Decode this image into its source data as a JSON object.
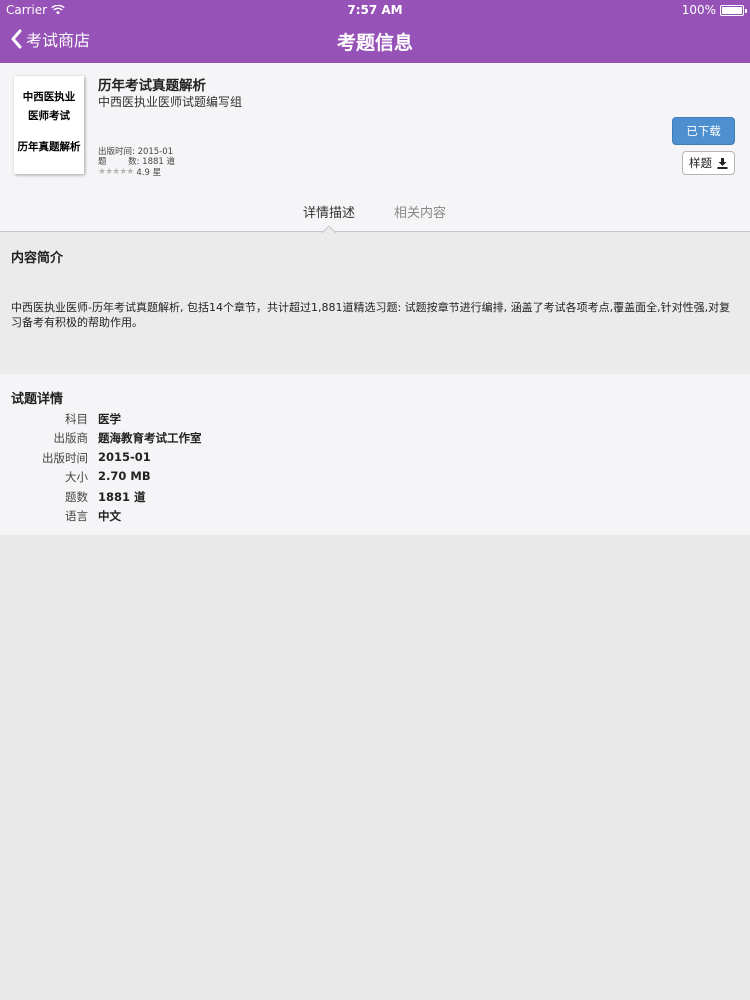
{
  "status_bar": {
    "carrier": "Carrier",
    "time": "7:57 AM",
    "battery": "100%"
  },
  "nav": {
    "back_label": "考试商店",
    "title": "考题信息"
  },
  "product": {
    "cover_lines": [
      "中西医执业",
      "医师考试",
      "历年真题解析"
    ],
    "title": "历年考试真题解析",
    "author": "中西医执业医师试题编写组",
    "publish_date_line": "出版时间: 2015-01",
    "question_count_line": "题        数: 1881 道",
    "rating_value": 0.0,
    "rating_text": "4.9 星",
    "downloaded_label": "已下载",
    "sample_label": "样题"
  },
  "tabs": {
    "details": "详情描述",
    "related": "相关内容",
    "active": "details"
  },
  "intro": {
    "heading": "内容简介",
    "text": "中西医执业医师-历年考试真题解析, 包括14个章节，共计超过1,881道精选习题: 试题按章节进行编排, 涵盖了考试各项考点,覆盖面全,针对性强,对复习备考有积极的帮助作用。"
  },
  "details": {
    "heading": "试题详情",
    "rows": [
      {
        "label": "科目",
        "value": "医学"
      },
      {
        "label": "出版商",
        "value": "题海教育考试工作室"
      },
      {
        "label": "出版时间",
        "value": "2015-01"
      },
      {
        "label": "大小",
        "value": "2.70 MB"
      },
      {
        "label": "题数",
        "value": "1881 道"
      },
      {
        "label": "语言",
        "value": "中文"
      }
    ]
  },
  "colors": {
    "nav_bar": "#9652b6",
    "primary_button": "#4d8fcf"
  },
  "icons": {
    "back": "chevron-left-icon",
    "wifi": "wifi-icon",
    "battery": "battery-icon",
    "download": "download-icon",
    "stars": "star-rating-icon"
  }
}
